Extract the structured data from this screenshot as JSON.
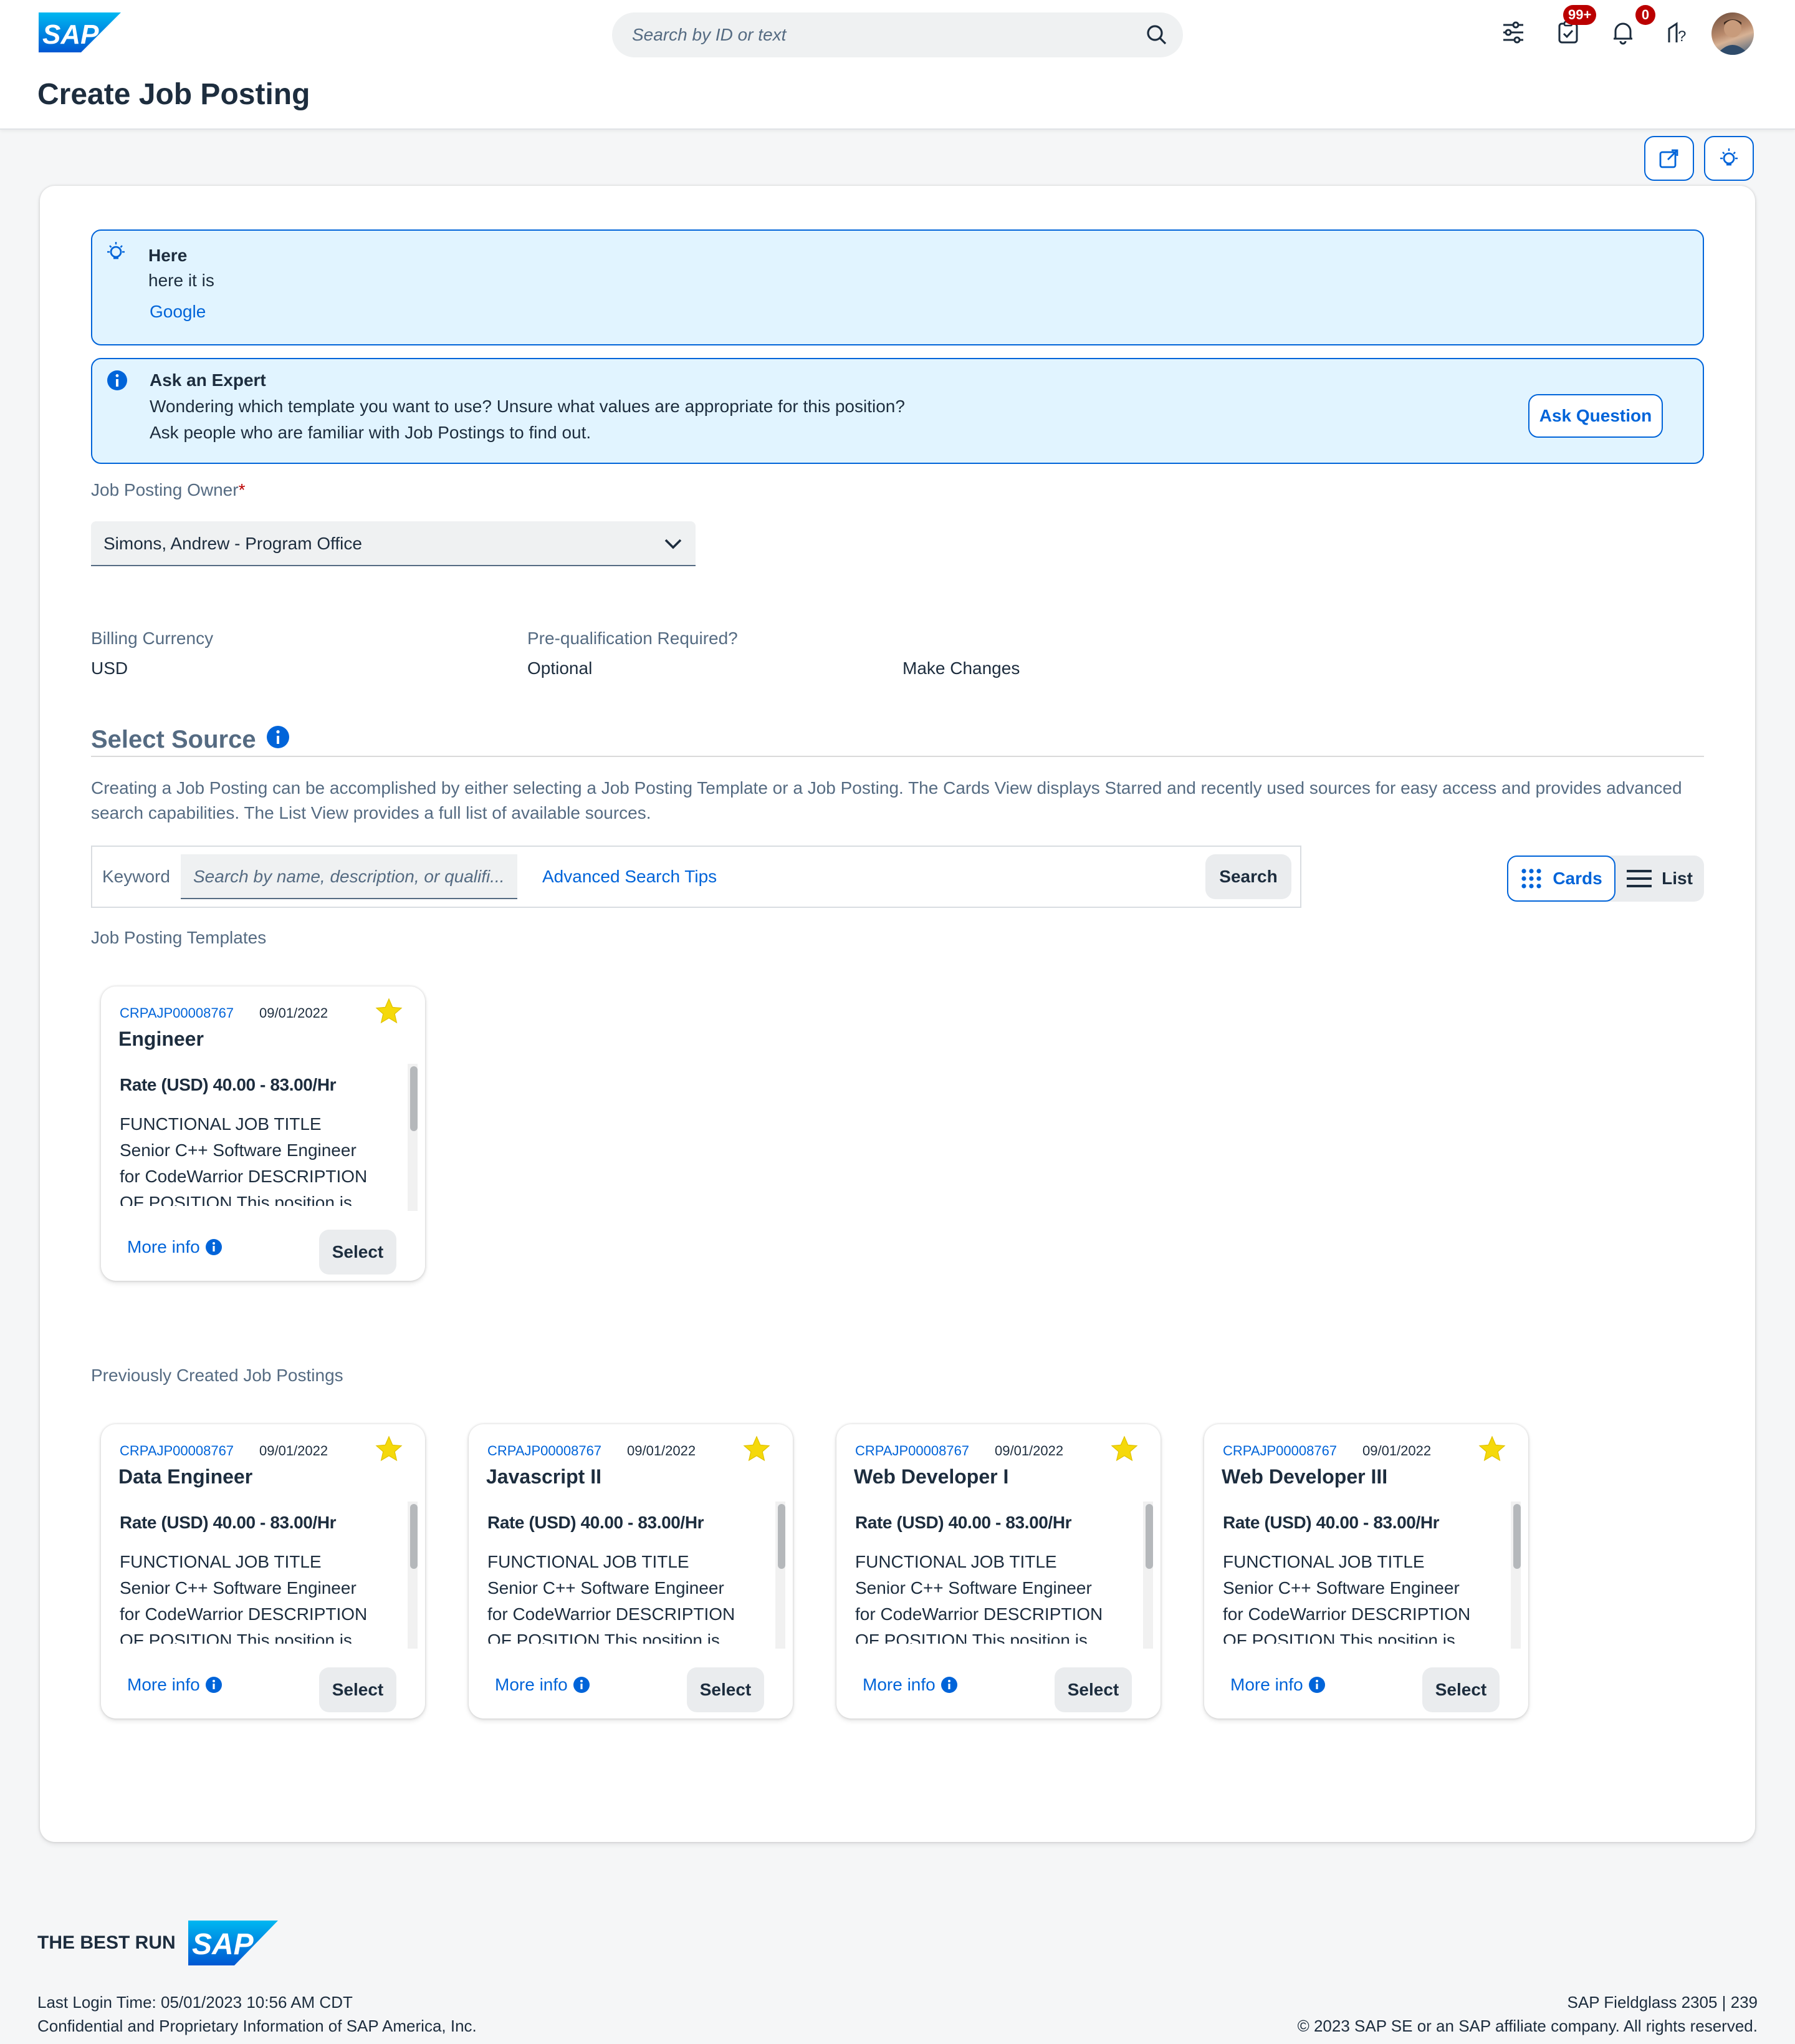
{
  "header": {
    "logo_text": "SAP",
    "search_placeholder": "Search by ID or text",
    "tasks_badge": "99+",
    "notifications_badge": "0",
    "page_title": "Create Job Posting"
  },
  "info_strip": {
    "title": "Here",
    "text": "here it is",
    "link": "Google"
  },
  "expert_strip": {
    "title": "Ask an Expert",
    "line1": "Wondering which template you want to use? Unsure what values are appropriate for this position?",
    "line2": "Ask people who are familiar with Job Postings to find out.",
    "button": "Ask Question"
  },
  "owner": {
    "label": "Job Posting Owner",
    "required_mark": "*",
    "value": "Simons, Andrew - Program Office"
  },
  "fields": {
    "billing_label": "Billing Currency",
    "billing_value": "USD",
    "prequal_label": "Pre-qualification Required?",
    "prequal_value": "Optional",
    "make_changes": "Make Changes"
  },
  "source": {
    "title": "Select Source",
    "description": "Creating a Job Posting can be accomplished by either selecting a Job Posting Template or a Job Posting. The Cards View displays Starred and recently used sources for easy access and provides advanced search capabilities. The List View provides a full list of available sources.",
    "keyword_label": "Keyword",
    "keyword_placeholder": "Search by name, description, or qualifi...",
    "advanced_tips": "Advanced Search Tips",
    "search_button": "Search",
    "cards_label": "Cards",
    "list_label": "List",
    "templates_label": "Job Posting Templates",
    "previous_label": "Previously Created Job Postings"
  },
  "cards": [
    {
      "id": "CRPAJP00008767",
      "date": "09/01/2022",
      "title": "Engineer",
      "rate": "Rate (USD) 40.00 - 83.00/Hr",
      "body": "FUNCTIONAL JOB TITLE Senior C++ Software Engineer for CodeWarrior DESCRIPTION OF POSITION This position is for a",
      "more": "More info",
      "select": "Select"
    },
    {
      "id": "CRPAJP00008767",
      "date": "09/01/2022",
      "title": "Data Engineer",
      "rate": "Rate (USD) 40.00 - 83.00/Hr",
      "body": "FUNCTIONAL JOB TITLE Senior C++ Software Engineer for CodeWarrior DESCRIPTION OF POSITION This position is for a",
      "more": "More info",
      "select": "Select"
    },
    {
      "id": "CRPAJP00008767",
      "date": "09/01/2022",
      "title": "Javascript II",
      "rate": "Rate (USD) 40.00 - 83.00/Hr",
      "body": "FUNCTIONAL JOB TITLE Senior C++ Software Engineer for CodeWarrior DESCRIPTION OF POSITION This position is for a",
      "more": "More info",
      "select": "Select"
    },
    {
      "id": "CRPAJP00008767",
      "date": "09/01/2022",
      "title": "Web Developer I",
      "rate": "Rate (USD) 40.00 - 83.00/Hr",
      "body": "FUNCTIONAL JOB TITLE Senior C++ Software Engineer for CodeWarrior DESCRIPTION OF POSITION This position is for a",
      "more": "More info",
      "select": "Select"
    },
    {
      "id": "CRPAJP00008767",
      "date": "09/01/2022",
      "title": "Web Developer III",
      "rate": "Rate (USD) 40.00 - 83.00/Hr",
      "body": "FUNCTIONAL JOB TITLE Senior C++ Software Engineer for CodeWarrior DESCRIPTION OF POSITION This position is for a",
      "more": "More info",
      "select": "Select"
    }
  ],
  "footer": {
    "best_run": "THE BEST RUN",
    "logo_text": "SAP",
    "last_login": "Last Login Time: 05/01/2023 10:56 AM CDT",
    "confidential": "Confidential and Proprietary Information of SAP America, Inc.",
    "version": "SAP Fieldglass 2305 | 239",
    "copyright": "© 2023 SAP SE or an SAP affiliate company. All rights reserved."
  },
  "colors": {
    "brand_blue": "#0064d9",
    "strip_bg": "#e1f4ff",
    "star": "#f5d90a",
    "badge": "#bb0000"
  }
}
